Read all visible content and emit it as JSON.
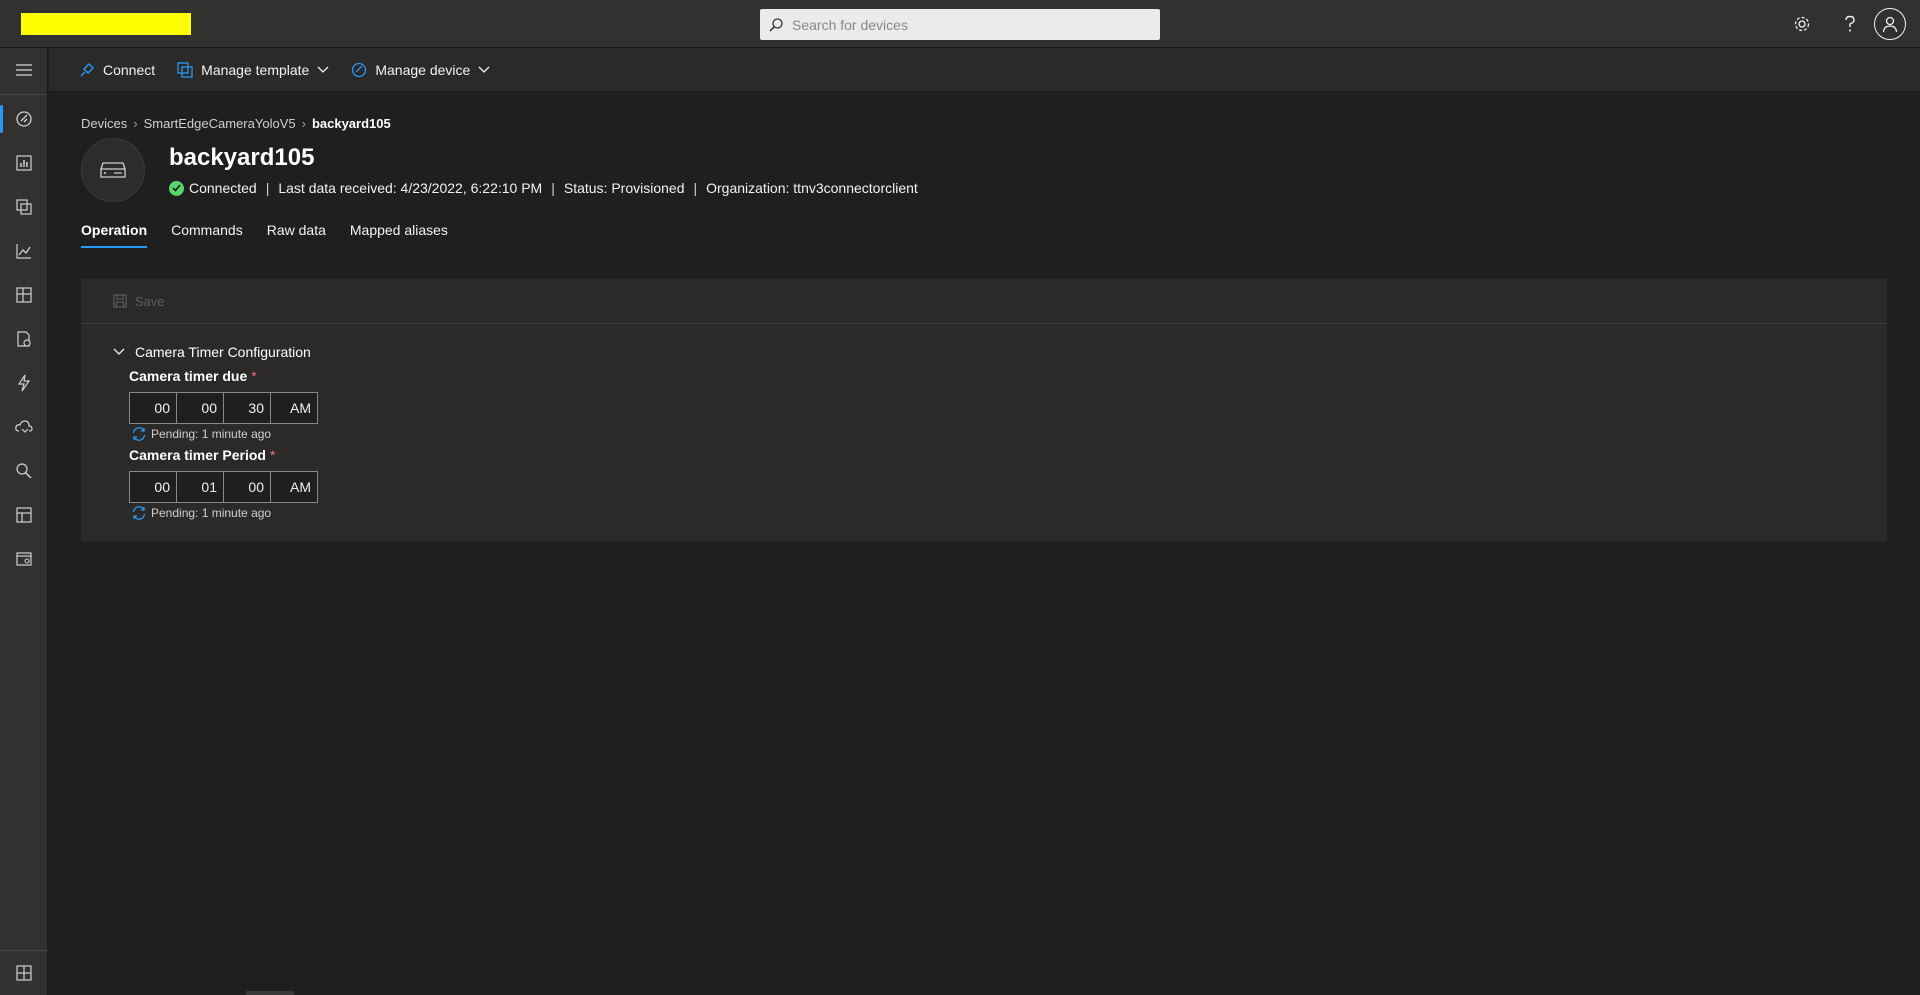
{
  "topbar": {
    "search_placeholder": "Search for devices",
    "icons": [
      "gear-icon",
      "help-icon",
      "user-avatar-icon"
    ]
  },
  "leftnav": {
    "items": [
      "devices-icon",
      "analytics-icon",
      "device-groups-icon",
      "charts-icon",
      "dashboards-icon",
      "jobs-icon",
      "rules-icon",
      "data-export-icon",
      "search-explore-icon",
      "templates-icon",
      "app-settings-icon"
    ],
    "bottom_item": "customize-icon"
  },
  "commandbar": {
    "connect": "Connect",
    "manage_template": "Manage template",
    "manage_device": "Manage device"
  },
  "breadcrumb": {
    "root": "Devices",
    "template": "SmartEdgeCameraYoloV5",
    "current": "backyard105"
  },
  "device": {
    "name": "backyard105",
    "status": "Connected",
    "last_data": "Last data received: 4/23/2022, 6:22:10 PM",
    "provisioning": "Status: Provisioned",
    "organization": "Organization: ttnv3connectorclient"
  },
  "tabs": [
    "Operation",
    "Commands",
    "Raw data",
    "Mapped aliases"
  ],
  "panel": {
    "save_label": "Save",
    "section_title": "Camera Timer Configuration",
    "fields": [
      {
        "label": "Camera timer due",
        "required_mark": "*",
        "hours": "00",
        "minutes": "00",
        "seconds": "30",
        "ampm": "AM",
        "pending": "Pending: 1 minute ago"
      },
      {
        "label": "Camera timer Period",
        "required_mark": "*",
        "hours": "00",
        "minutes": "01",
        "seconds": "00",
        "ampm": "AM",
        "pending": "Pending: 1 minute ago"
      }
    ]
  },
  "colors": {
    "accent": "#2899f5",
    "connected": "#57d66b",
    "required": "#f1707b"
  }
}
